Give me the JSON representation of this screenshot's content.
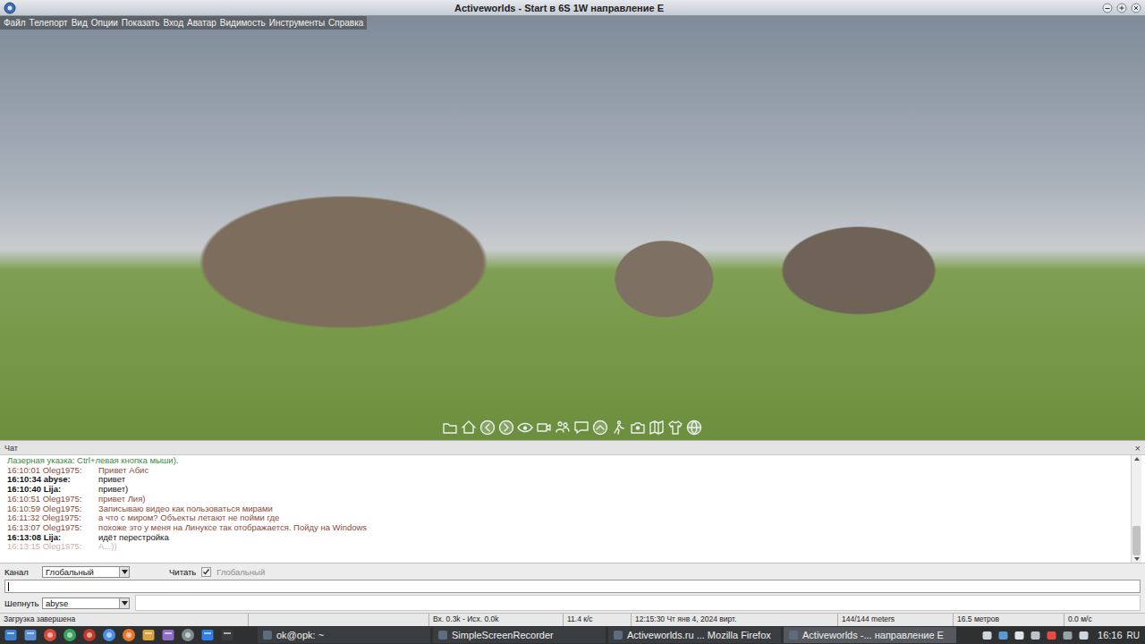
{
  "window": {
    "title": "Activeworlds - Start в 6S 1W направление E"
  },
  "menu": [
    "Файл",
    "Телепорт",
    "Вид",
    "Опции",
    "Показать",
    "Вход",
    "Аватар",
    "Видимость",
    "Инструменты",
    "Справка"
  ],
  "chat": {
    "title": "Чат",
    "close": "×",
    "scroll": {
      "level": 1
    },
    "lines": [
      {
        "kind": "notice",
        "time": "",
        "name": "",
        "text": "Лазерная указка: Ctrl+левая кнопка мыши).",
        "color": "#3a8a3a",
        "faded": false
      },
      {
        "kind": "message",
        "time": "16:10:01",
        "name": "Oleg1975:",
        "text": "Привет Абис",
        "color": "#8a4b3b",
        "faded": false
      },
      {
        "kind": "message",
        "time": "16:10:34",
        "name": "abyse:",
        "text": "привет",
        "color": "#111111",
        "faded": false
      },
      {
        "kind": "message",
        "time": "16:10:40",
        "name": "Lija:",
        "text": "привет)",
        "color": "#111111",
        "faded": false
      },
      {
        "kind": "message",
        "time": "16:10:51",
        "name": "Oleg1975:",
        "text": "привет Лия)",
        "color": "#8a4b3b",
        "faded": false
      },
      {
        "kind": "message",
        "time": "16:10:59",
        "name": "Oleg1975:",
        "text": "Записываю видео как пользоваться мирами",
        "color": "#8a4b3b",
        "faded": false
      },
      {
        "kind": "message",
        "time": "16:11:32",
        "name": "Oleg1975:",
        "text": "а что с миром? Объекты летают не пойми где",
        "color": "#8a4b3b",
        "faded": false
      },
      {
        "kind": "message",
        "time": "16:13:07",
        "name": "Oleg1975:",
        "text": "похоже это у меня на Линуксе так отображается. Пойду на Windows",
        "color": "#8a4b3b",
        "faded": false
      },
      {
        "kind": "message",
        "time": "16:13:08",
        "name": "Lija:",
        "text": "идёт перестройка",
        "color": "#111111",
        "faded": false
      },
      {
        "kind": "message",
        "time": "16:13:15",
        "name": "Oleg1975:",
        "text": "А...))",
        "color": "#8a4b3b",
        "faded": true
      }
    ]
  },
  "channel": {
    "label": "Канал",
    "value": "Глобальный",
    "read_label": "Читать",
    "read_checked": true,
    "read_value": "Глобальный",
    "read_disabled": true
  },
  "input": {
    "value": ""
  },
  "whisper": {
    "label": "Шепнуть",
    "value": "abyse"
  },
  "status_bar": [
    "Загрузка завершена",
    "",
    "Вх. 0.3k - Исх. 0.0k",
    "11.4 к/с",
    "12:15:30 Чт янв 4, 2024 вирт.",
    "144/144 meters",
    "16.5 метров",
    "0.0 м/с"
  ],
  "taskbar": {
    "tasks": [
      {
        "label": "ok@opk: ~",
        "selected": false
      },
      {
        "label": "SimpleScreenRecorder",
        "selected": false
      },
      {
        "label": "Activeworlds.ru ... Mozilla Firefox",
        "selected": false
      },
      {
        "label": "Activeworlds -... направление E",
        "selected": true
      }
    ],
    "clock": "16:16",
    "layout": "RU"
  }
}
